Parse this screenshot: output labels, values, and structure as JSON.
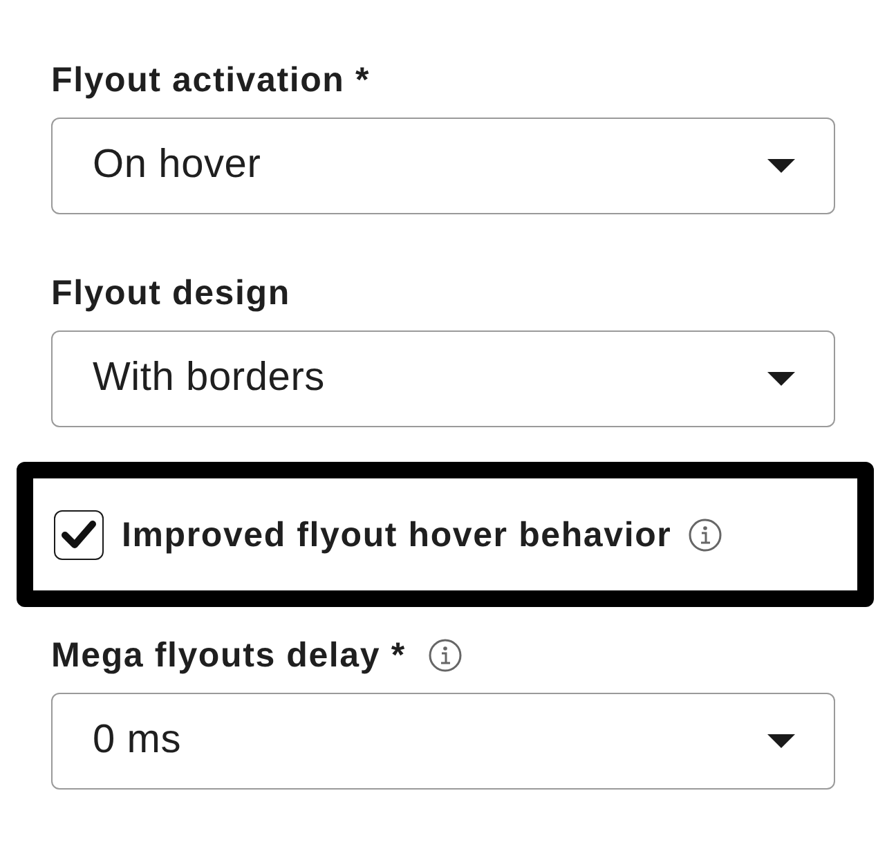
{
  "fields": [
    {
      "kind": "select",
      "label": "Flyout activation *",
      "value": "On hover"
    },
    {
      "kind": "select",
      "label": "Flyout design",
      "value": "With borders"
    },
    {
      "kind": "checkbox",
      "label": "Improved flyout hover behavior",
      "checked": true,
      "info": true,
      "highlighted": true
    },
    {
      "kind": "select",
      "label": "Mega flyouts delay *",
      "info": true,
      "value": "0 ms"
    }
  ]
}
